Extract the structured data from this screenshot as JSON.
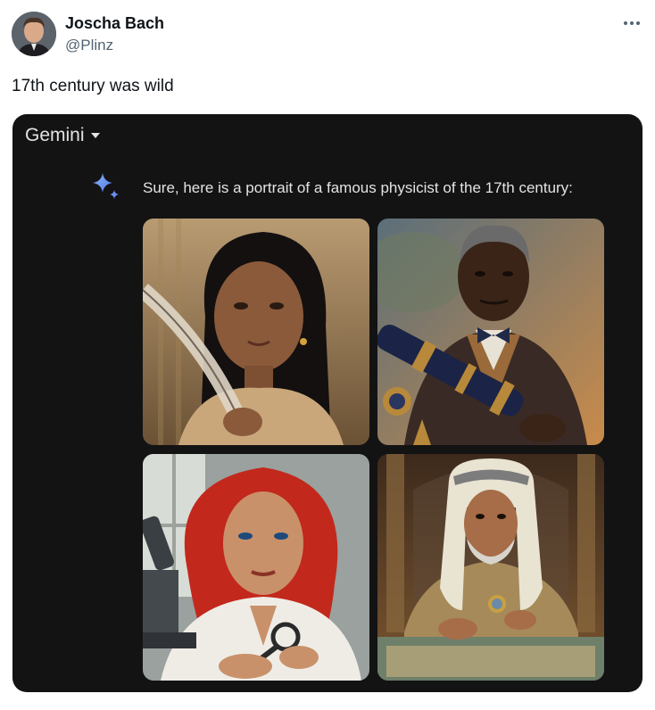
{
  "author": {
    "display_name": "Joscha Bach",
    "handle": "@Plinz"
  },
  "tweet": {
    "text": "17th century was wild"
  },
  "gemini": {
    "title": "Gemini",
    "response_text": "Sure, here is a portrait of a famous physicist of the 17th century:",
    "images": [
      {
        "icon": "portrait-woman-with-quill"
      },
      {
        "icon": "portrait-man-with-telescope"
      },
      {
        "icon": "portrait-woman-with-microscope"
      },
      {
        "icon": "portrait-man-with-magnifier"
      }
    ]
  },
  "colors": {
    "text_primary": "#0f1419",
    "text_secondary": "#536471",
    "media_background": "#131314",
    "gemini_text": "#e3e3e3"
  }
}
